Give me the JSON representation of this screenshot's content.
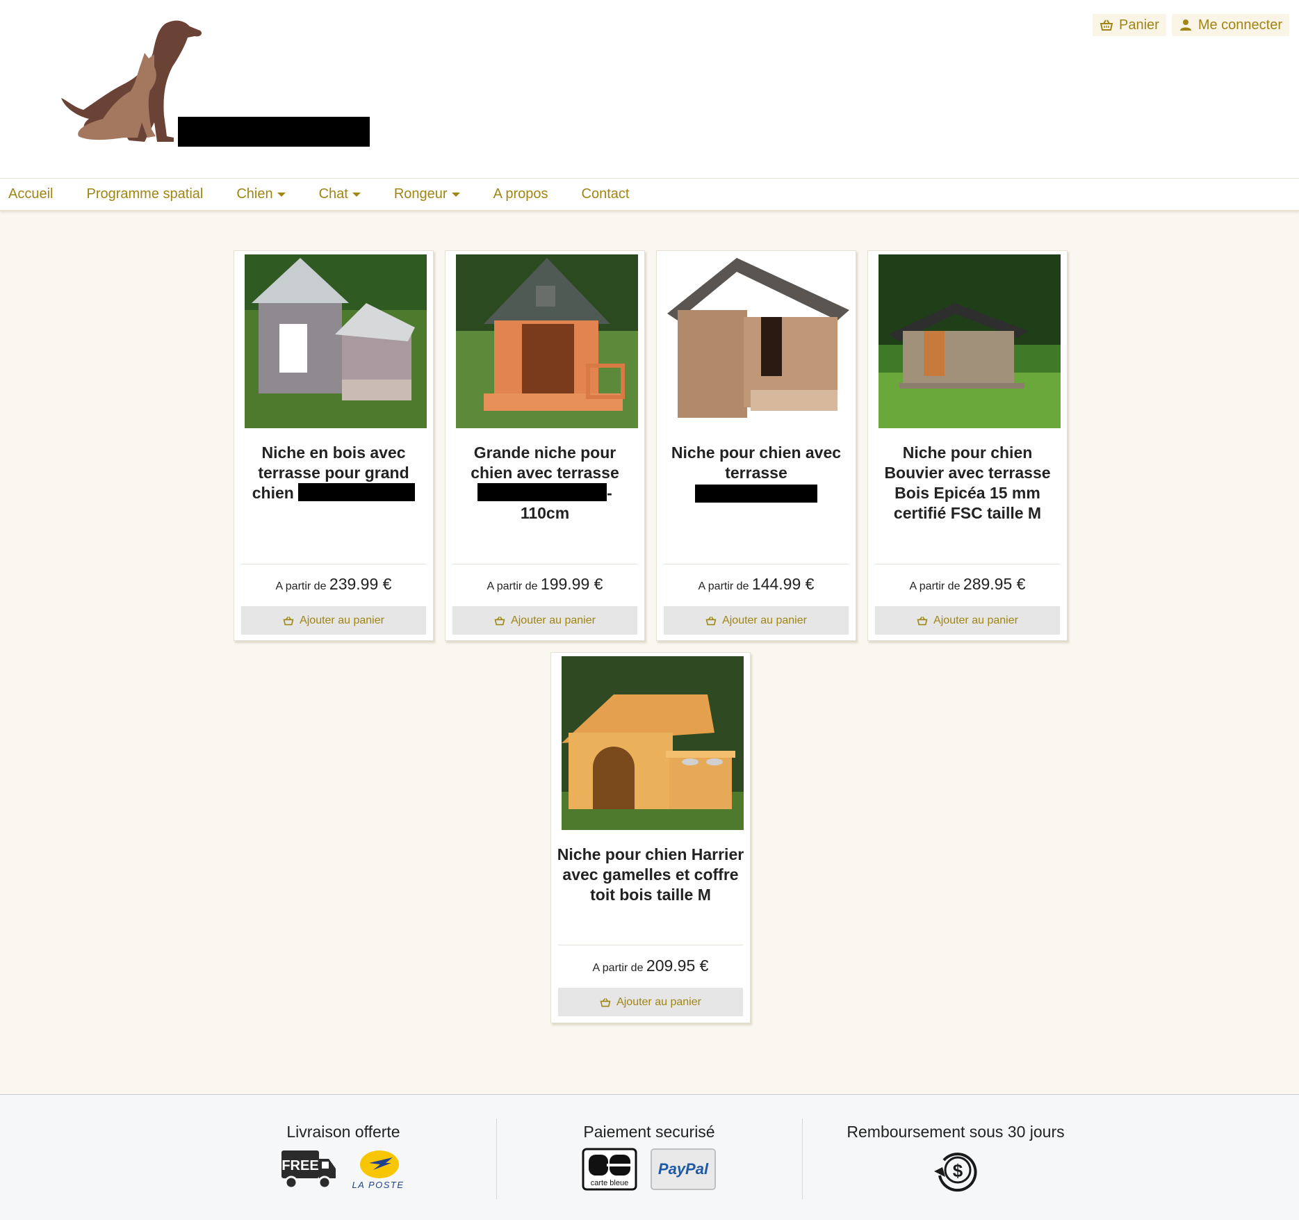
{
  "header": {
    "cart_label": "Panier",
    "login_label": "Me connecter"
  },
  "nav": {
    "items": [
      {
        "label": "Accueil"
      },
      {
        "label": "Programme spatial"
      },
      {
        "label": "Chien"
      },
      {
        "label": "Chat"
      },
      {
        "label": "Rongeur"
      },
      {
        "label": "A propos"
      },
      {
        "label": "Contact"
      }
    ]
  },
  "products": [
    {
      "title": "Niche en bois avec terrasse pour grand chien",
      "price_prefix": "A partir de",
      "price": "239.99 €",
      "button": "Ajouter au panier"
    },
    {
      "title": "Grande niche pour chien avec terrasse",
      "title_suffix": "- 110cm",
      "price_prefix": "A partir de",
      "price": "199.99 €",
      "button": "Ajouter au panier"
    },
    {
      "title": "Niche pour chien avec terrasse",
      "price_prefix": "A partir de",
      "price": "144.99 €",
      "button": "Ajouter au panier"
    },
    {
      "title": "Niche pour chien Bouvier avec terrasse Bois Epicéa 15 mm certifié FSC taille M",
      "price_prefix": "A partir de",
      "price": "289.95 €",
      "button": "Ajouter au panier"
    },
    {
      "title": "Niche pour chien Harrier avec gamelles et coffre toit bois taille M",
      "price_prefix": "A partir de",
      "price": "209.95 €",
      "button": "Ajouter au panier"
    }
  ],
  "footer": {
    "delivery": {
      "title": "Livraison offerte",
      "free_text": "FREE",
      "laposte_text": "LA POSTE"
    },
    "payment": {
      "title": "Paiement securisé",
      "cb_text": "carte bleue",
      "paypal_text": "PayPal"
    },
    "refund": {
      "title": "Remboursement sous 30 jours"
    }
  },
  "colors": {
    "accent": "#a08514",
    "page_bg": "#faf7f1",
    "logo_dark": "#6b4336",
    "logo_light": "#a4775f"
  }
}
